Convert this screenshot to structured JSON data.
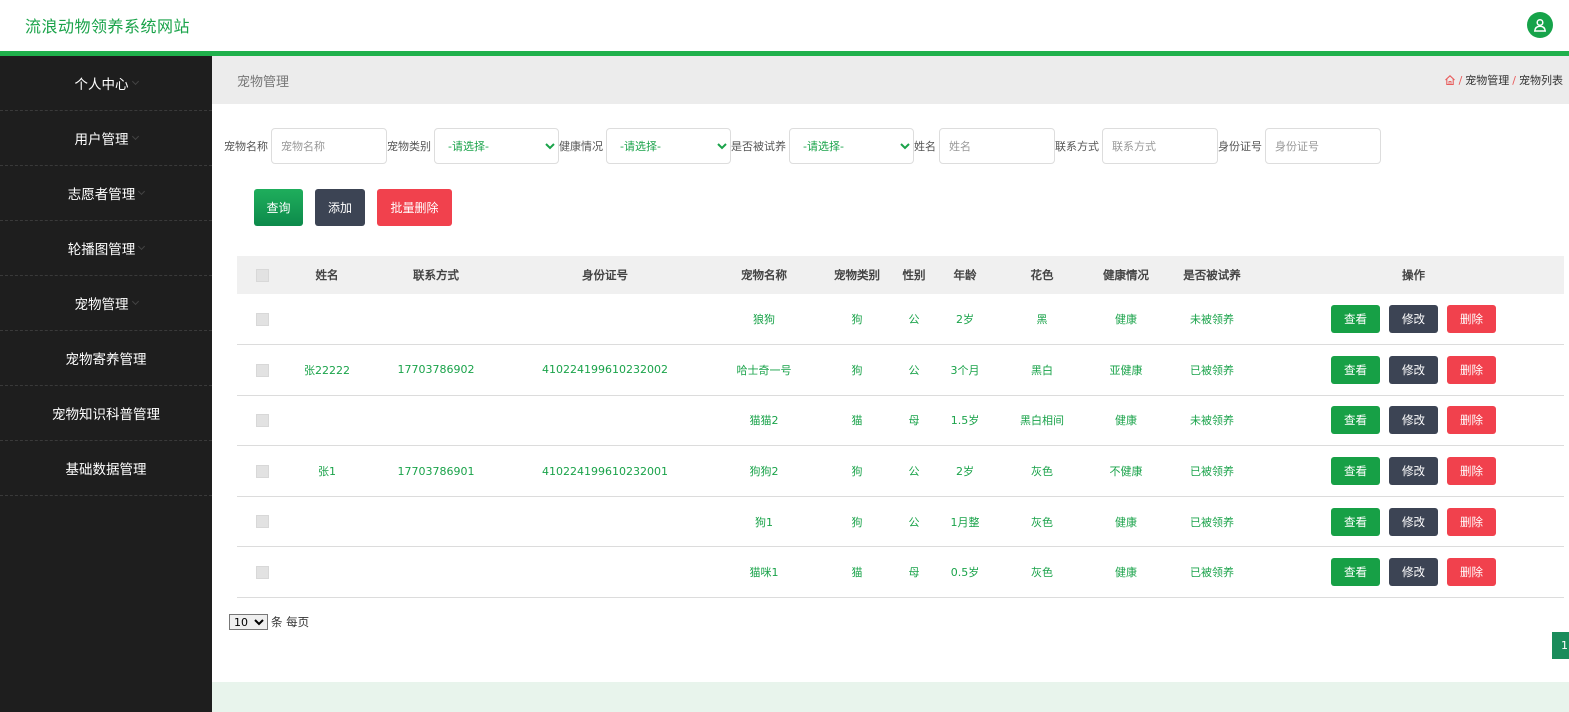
{
  "app": {
    "title": "流浪动物领养系统网站"
  },
  "sidebar": {
    "items": [
      {
        "label": "个人中心"
      },
      {
        "label": "用户管理"
      },
      {
        "label": "志愿者管理"
      },
      {
        "label": "轮播图管理"
      },
      {
        "label": "宠物管理"
      },
      {
        "label": "宠物寄养管理"
      },
      {
        "label": "宠物知识科普管理"
      },
      {
        "label": "基础数据管理"
      }
    ]
  },
  "breadcrumb": {
    "title": "宠物管理",
    "sep": "/",
    "items": [
      "宠物管理",
      "宠物列表"
    ]
  },
  "search": {
    "pet_name_label": "宠物名称",
    "pet_name_placeholder": "宠物名称",
    "pet_type_label": "宠物类别",
    "pet_type_value": "-请选择-",
    "health_label": "健康情况",
    "health_value": "-请选择-",
    "trial_label": "是否被试养",
    "trial_value": "-请选择-",
    "name_label": "姓名",
    "name_placeholder": "姓名",
    "phone_label": "联系方式",
    "phone_placeholder": "联系方式",
    "idcard_label": "身份证号",
    "idcard_placeholder": "身份证号"
  },
  "buttons": {
    "query": "查询",
    "add": "添加",
    "batch_delete": "批量删除"
  },
  "table": {
    "headers": [
      "姓名",
      "联系方式",
      "身份证号",
      "宠物名称",
      "宠物类别",
      "性别",
      "年龄",
      "花色",
      "健康情况",
      "是否被试养",
      "操作"
    ],
    "rows": [
      {
        "name": "",
        "phone": "",
        "idcard": "",
        "pet": "狼狗",
        "type": "狗",
        "sex": "公",
        "age": "2岁",
        "color": "黑",
        "health": "健康",
        "adopt": "未被领养"
      },
      {
        "name": "张22222",
        "phone": "17703786902",
        "idcard": "410224199610232002",
        "pet": "哈士奇一号",
        "type": "狗",
        "sex": "公",
        "age": "3个月",
        "color": "黑白",
        "health": "亚健康",
        "adopt": "已被领养"
      },
      {
        "name": "",
        "phone": "",
        "idcard": "",
        "pet": "猫猫2",
        "type": "猫",
        "sex": "母",
        "age": "1.5岁",
        "color": "黑白相间",
        "health": "健康",
        "adopt": "未被领养"
      },
      {
        "name": "张1",
        "phone": "17703786901",
        "idcard": "410224199610232001",
        "pet": "狗狗2",
        "type": "狗",
        "sex": "公",
        "age": "2岁",
        "color": "灰色",
        "health": "不健康",
        "adopt": "已被领养"
      },
      {
        "name": "",
        "phone": "",
        "idcard": "",
        "pet": "狗1",
        "type": "狗",
        "sex": "公",
        "age": "1月整",
        "color": "灰色",
        "health": "健康",
        "adopt": "已被领养"
      },
      {
        "name": "",
        "phone": "",
        "idcard": "",
        "pet": "猫咪1",
        "type": "猫",
        "sex": "母",
        "age": "0.5岁",
        "color": "灰色",
        "health": "健康",
        "adopt": "已被领养"
      }
    ],
    "ops": {
      "view": "查看",
      "edit": "修改",
      "delete": "删除"
    }
  },
  "pager": {
    "page_size": "10",
    "per_page_text": "条 每页",
    "current_page": "1"
  },
  "colors": {
    "accent": "#20b14c",
    "sidebar_bg": "#1e1e1e",
    "danger": "#f1414d",
    "dark_button": "#3c4454"
  },
  "icons": {
    "user": "user-icon",
    "home": "home-icon"
  }
}
